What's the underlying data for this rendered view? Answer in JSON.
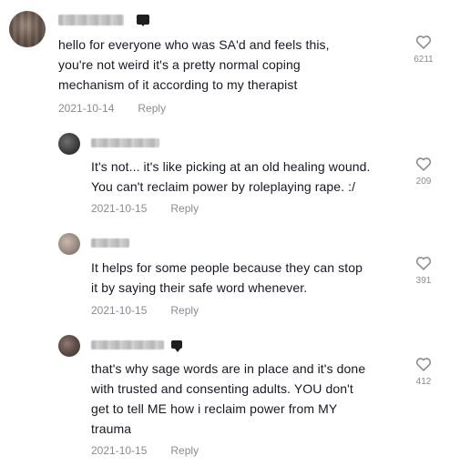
{
  "comments": [
    {
      "text": "hello for everyone who was SA'd and feels this,\nyou're not weird it's a pretty normal coping\nmechanism of it according to my therapist",
      "date": "2021-10-14",
      "reply": "Reply",
      "likes": "6211"
    },
    {
      "text": "It's not... it's like picking at an old healing wound.\nYou can't reclaim power by roleplaying rape. :/",
      "date": "2021-10-15",
      "reply": "Reply",
      "likes": "209"
    },
    {
      "text": "It helps for some people because they can stop\nit by saying their safe word whenever.",
      "date": "2021-10-15",
      "reply": "Reply",
      "likes": "391"
    },
    {
      "text": "that's why sage words are in place and it's done\nwith trusted and consenting adults. YOU don't\nget to tell ME how i reclaim power from MY\ntrauma",
      "date": "2021-10-15",
      "reply": "Reply",
      "likes": "412"
    }
  ],
  "icons": {
    "like": "heart-outline-icon",
    "creator": "creator-badge-icon"
  },
  "colors": {
    "text": "#161823",
    "meta": "#8a8b91",
    "icon": "#8a8b91"
  }
}
